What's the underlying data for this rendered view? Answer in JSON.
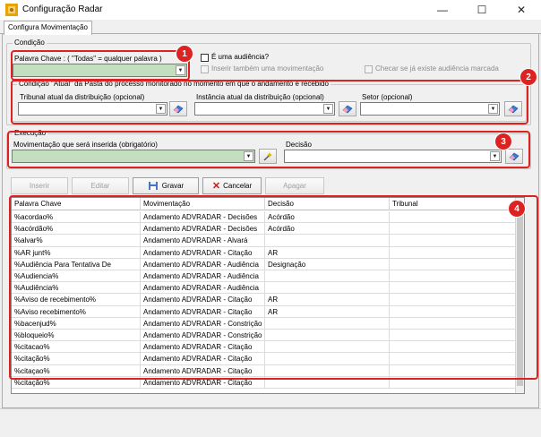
{
  "window": {
    "title": "Configuração Radar",
    "minimize": "—",
    "maximize": "☐",
    "close": "✕"
  },
  "tab": {
    "label": "Configura Movimentação"
  },
  "condicao": {
    "group_title": "Condição",
    "palavra_label": "Palavra Chave :  ( \"Todas\" = qualquer palavra )",
    "palavra_value": "",
    "audiencia_label": "É uma audiência?",
    "audiencia_checked": false,
    "inserir_mov_label": "Inserir também uma movimentação",
    "checar_label": "Checar se já existe audiência marcada"
  },
  "condicao_atual": {
    "group_title": "Condição \"Atual\" da Pasta do processo monitorado no momento em que o andamento é recebido",
    "tribunal_label": "Tribunal atual da distribuição (opcional)",
    "instancia_label": "Instância atual da distribuição  (opcional)",
    "setor_label": "Setor  (opcional)"
  },
  "execucao": {
    "group_title": "Execução",
    "mov_label": "Movimentação que será inserida (obrigatório)",
    "decisao_label": "Decisão"
  },
  "toolbar": {
    "inserir": "Inserir",
    "editar": "Editar",
    "gravar": "Gravar",
    "cancelar": "Cancelar",
    "apagar": "Apagar"
  },
  "grid": {
    "columns": [
      "Palavra Chave",
      "Movimentação",
      "Decisão",
      "Tribunal"
    ],
    "rows": [
      [
        "%acordao%",
        "Andamento ADVRADAR - Decisões",
        "Acórdão",
        ""
      ],
      [
        "%acórdão%",
        "Andamento ADVRADAR - Decisões",
        "Acórdão",
        ""
      ],
      [
        "%alvar%",
        "Andamento ADVRADAR - Alvará",
        "",
        ""
      ],
      [
        "%AR junt%",
        "Andamento ADVRADAR - Citação",
        "AR",
        ""
      ],
      [
        "%Audiência Para Tentativa De",
        "Andamento ADVRADAR - Audiência",
        "Designação",
        ""
      ],
      [
        "%Audiencia%",
        "Andamento ADVRADAR - Audiência",
        "",
        ""
      ],
      [
        "%Audiência%",
        "Andamento ADVRADAR - Audiência",
        "",
        ""
      ],
      [
        "%Aviso de recebimento%",
        "Andamento ADVRADAR - Citação",
        "AR",
        ""
      ],
      [
        "%Aviso recebimento%",
        "Andamento ADVRADAR - Citação",
        "AR",
        ""
      ],
      [
        "%bacenjud%",
        "Andamento ADVRADAR - Constrição",
        "",
        ""
      ],
      [
        "%bloqueio%",
        "Andamento ADVRADAR - Constrição",
        "",
        ""
      ],
      [
        "%citacao%",
        "Andamento ADVRADAR - Citação",
        "",
        ""
      ],
      [
        "%citação%",
        "Andamento ADVRADAR - Citação",
        "",
        ""
      ],
      [
        "%citaçao%",
        "Andamento ADVRADAR - Citação",
        "",
        ""
      ],
      [
        "%citação%",
        "Andamento ADVRADAR - Citação",
        "",
        ""
      ]
    ]
  },
  "badges": [
    "1",
    "2",
    "3",
    "4"
  ],
  "colors": {
    "highlight": "#dd2222",
    "combo_green": "#c5dec0"
  }
}
